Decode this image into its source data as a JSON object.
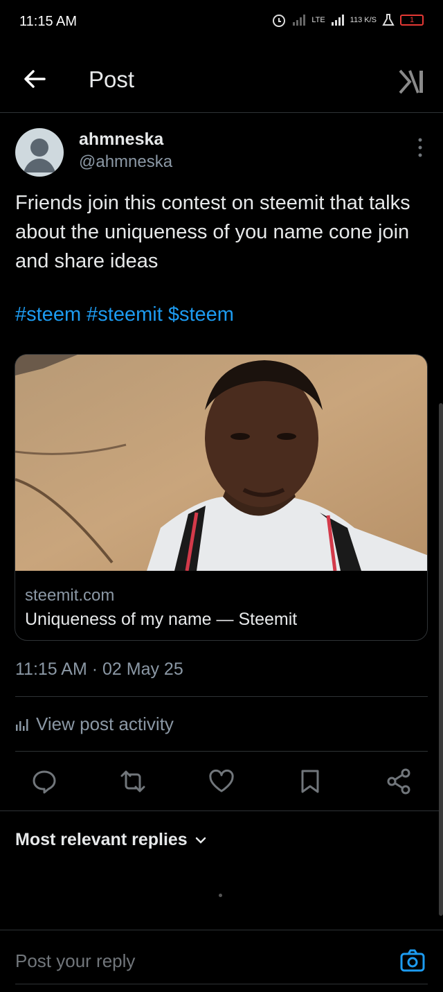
{
  "status_bar": {
    "time": "11:15 AM",
    "network": "LTE",
    "speed": "113 K/S",
    "battery": "1"
  },
  "header": {
    "title": "Post"
  },
  "post": {
    "display_name": "ahmneska",
    "handle": "@ahmneska",
    "text": "Friends join this contest on steemit that talks about the uniqueness of you name cone join and share ideas",
    "tags": "#steem #steemit $steem",
    "card": {
      "domain": "steemit.com",
      "title": "Uniqueness of my name — Steemit"
    },
    "timestamp": "11:15 AM · 02 May 25",
    "activity_label": "View post activity"
  },
  "replies": {
    "sort_label": "Most relevant replies"
  },
  "composer": {
    "placeholder": "Post your reply"
  },
  "colors": {
    "accent": "#1d9bf0",
    "background": "#000000",
    "muted": "#8b98a5"
  }
}
